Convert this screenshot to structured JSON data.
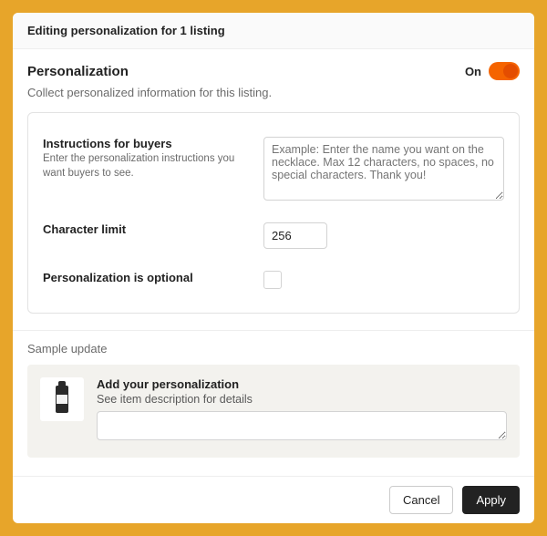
{
  "header": {
    "title": "Editing personalization for 1 listing"
  },
  "section": {
    "title": "Personalization",
    "toggle_label": "On",
    "toggle_on": true,
    "description": "Collect personalized information for this listing."
  },
  "instructions": {
    "title": "Instructions for buyers",
    "help": "Enter the personalization instructions you want buyers to see.",
    "placeholder": "Example: Enter the name you want on the necklace. Max 12 characters, no spaces, no special characters. Thank you!"
  },
  "charlimit": {
    "title": "Character limit",
    "value": "256"
  },
  "optional": {
    "title": "Personalization is optional",
    "checked": false
  },
  "sample": {
    "section_label": "Sample update",
    "heading": "Add your personalization",
    "sub": "See item description for details",
    "value": ""
  },
  "footer": {
    "cancel": "Cancel",
    "apply": "Apply"
  }
}
